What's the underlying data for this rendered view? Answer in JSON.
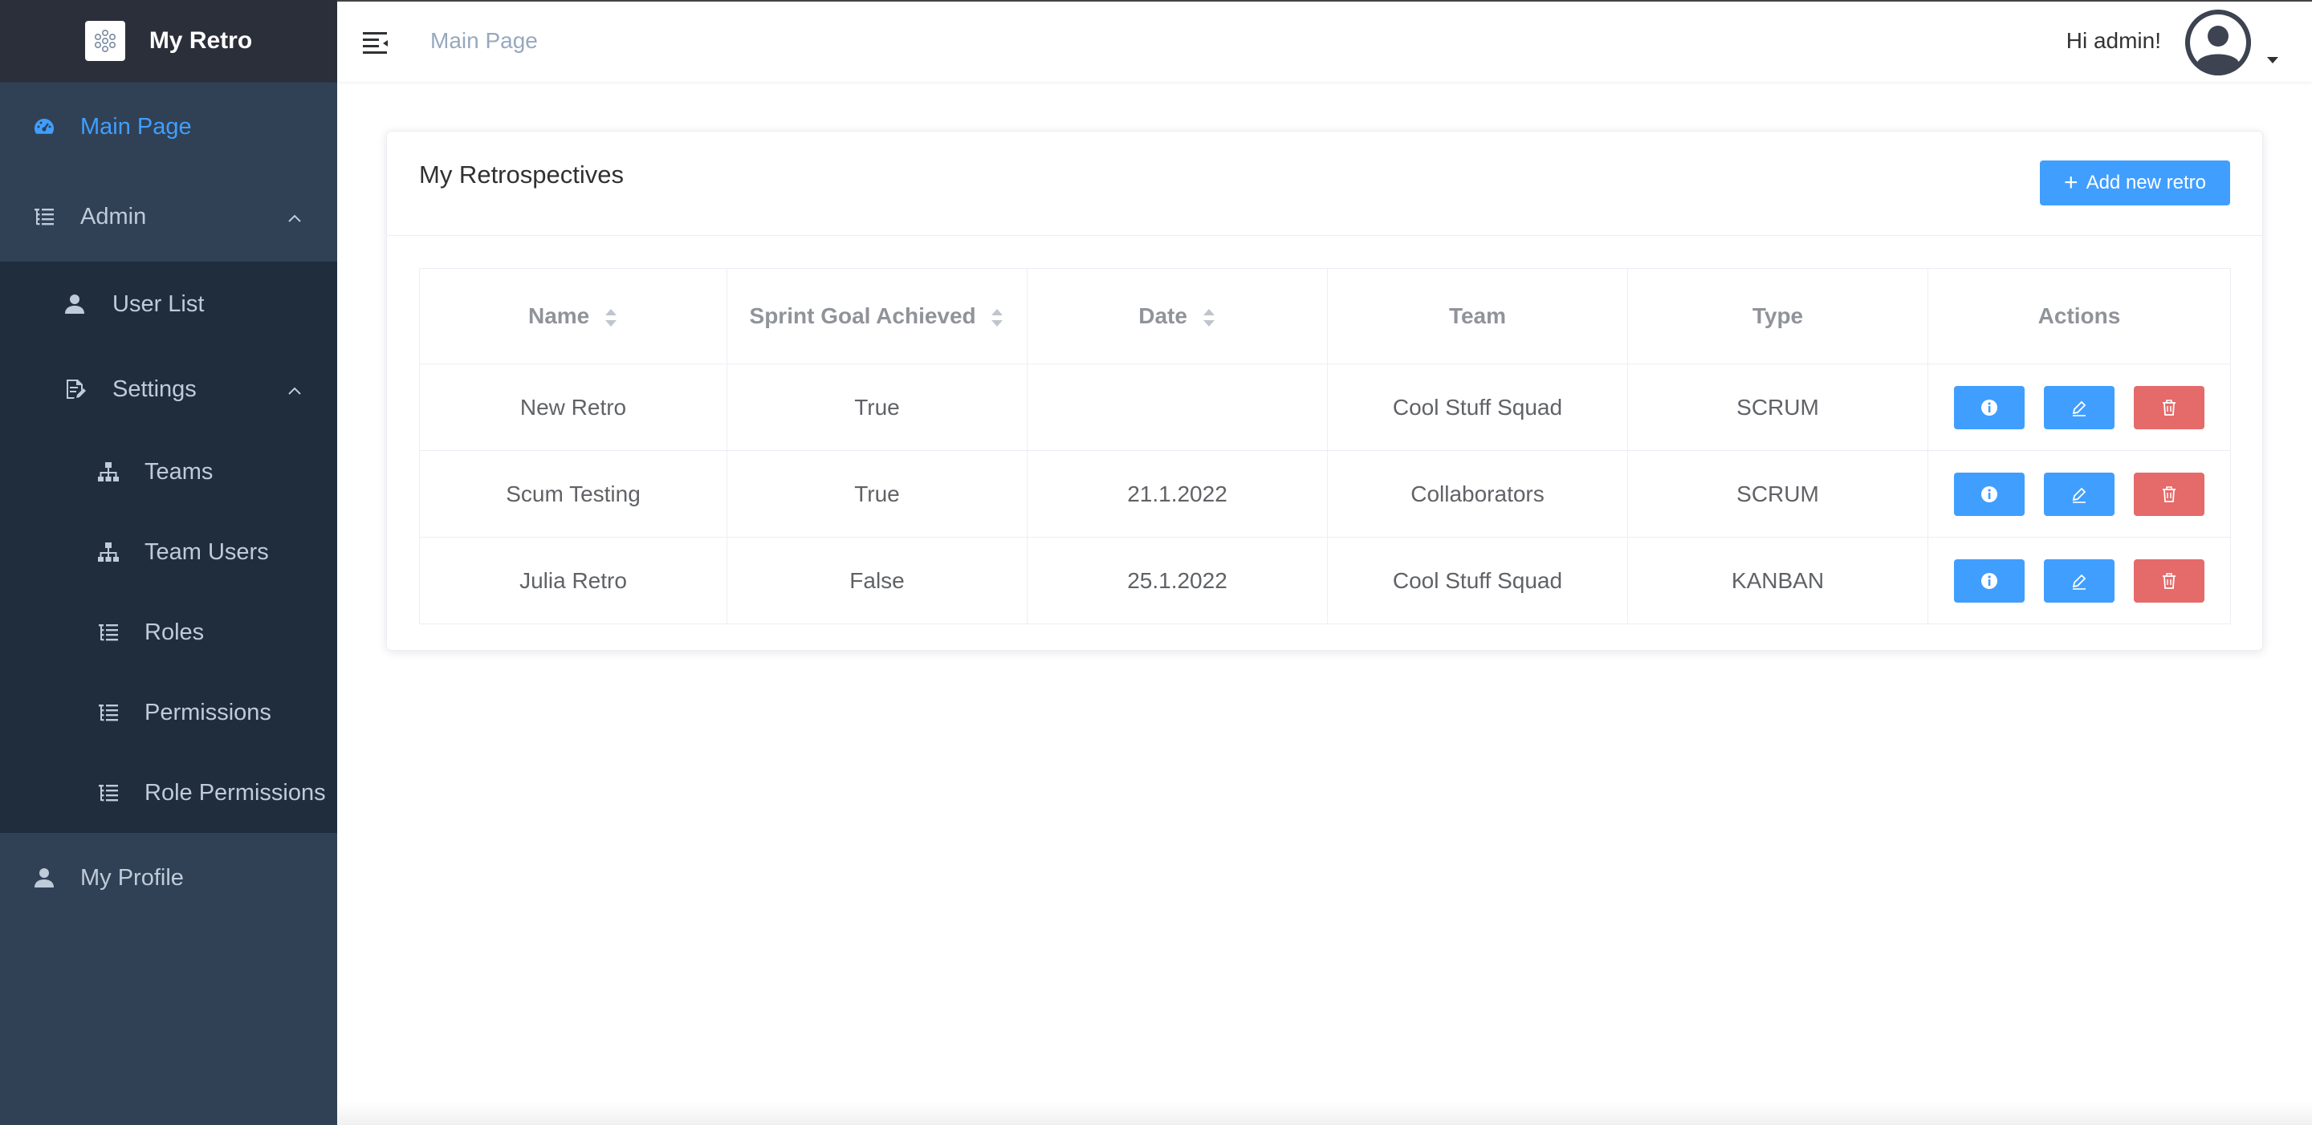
{
  "app": {
    "title": "My Retro",
    "logo_icon": "flower-logo-icon"
  },
  "sidebar": {
    "items": [
      {
        "label": "Main Page",
        "icon": "dashboard-icon",
        "active": true
      },
      {
        "label": "Admin",
        "icon": "list-icon",
        "expanded": true
      },
      {
        "label": "User List",
        "icon": "user-icon"
      },
      {
        "label": "Settings",
        "icon": "edit-document-icon",
        "expanded": true
      },
      {
        "label": "Teams",
        "icon": "hierarchy-icon"
      },
      {
        "label": "Team Users",
        "icon": "hierarchy-icon"
      },
      {
        "label": "Roles",
        "icon": "list-icon"
      },
      {
        "label": "Permissions",
        "icon": "list-icon"
      },
      {
        "label": "Role Permissions",
        "icon": "list-icon"
      },
      {
        "label": "My Profile",
        "icon": "user-icon"
      }
    ]
  },
  "header": {
    "breadcrumb": "Main Page",
    "greeting": "Hi admin!"
  },
  "card": {
    "title": "My Retrospectives",
    "add_button_label": "Add new retro"
  },
  "table": {
    "columns": [
      "Name",
      "Sprint Goal Achieved",
      "Date",
      "Team",
      "Type",
      "Actions"
    ],
    "rows": [
      {
        "name": "New Retro",
        "goal": "True",
        "date": "",
        "team": "Cool Stuff Squad",
        "type": "SCRUM"
      },
      {
        "name": "Scum Testing",
        "goal": "True",
        "date": "21.1.2022",
        "team": "Collaborators",
        "type": "SCRUM"
      },
      {
        "name": "Julia Retro",
        "goal": "False",
        "date": "25.1.2022",
        "team": "Cool Stuff Squad",
        "type": "KANBAN"
      }
    ]
  },
  "colors": {
    "sidebar_bg": "#304156",
    "submenu_bg": "#1f2d3d",
    "accent": "#409eff",
    "danger": "#e56a6a",
    "true_color": "#2e7d12",
    "false_color": "#e0201a"
  }
}
